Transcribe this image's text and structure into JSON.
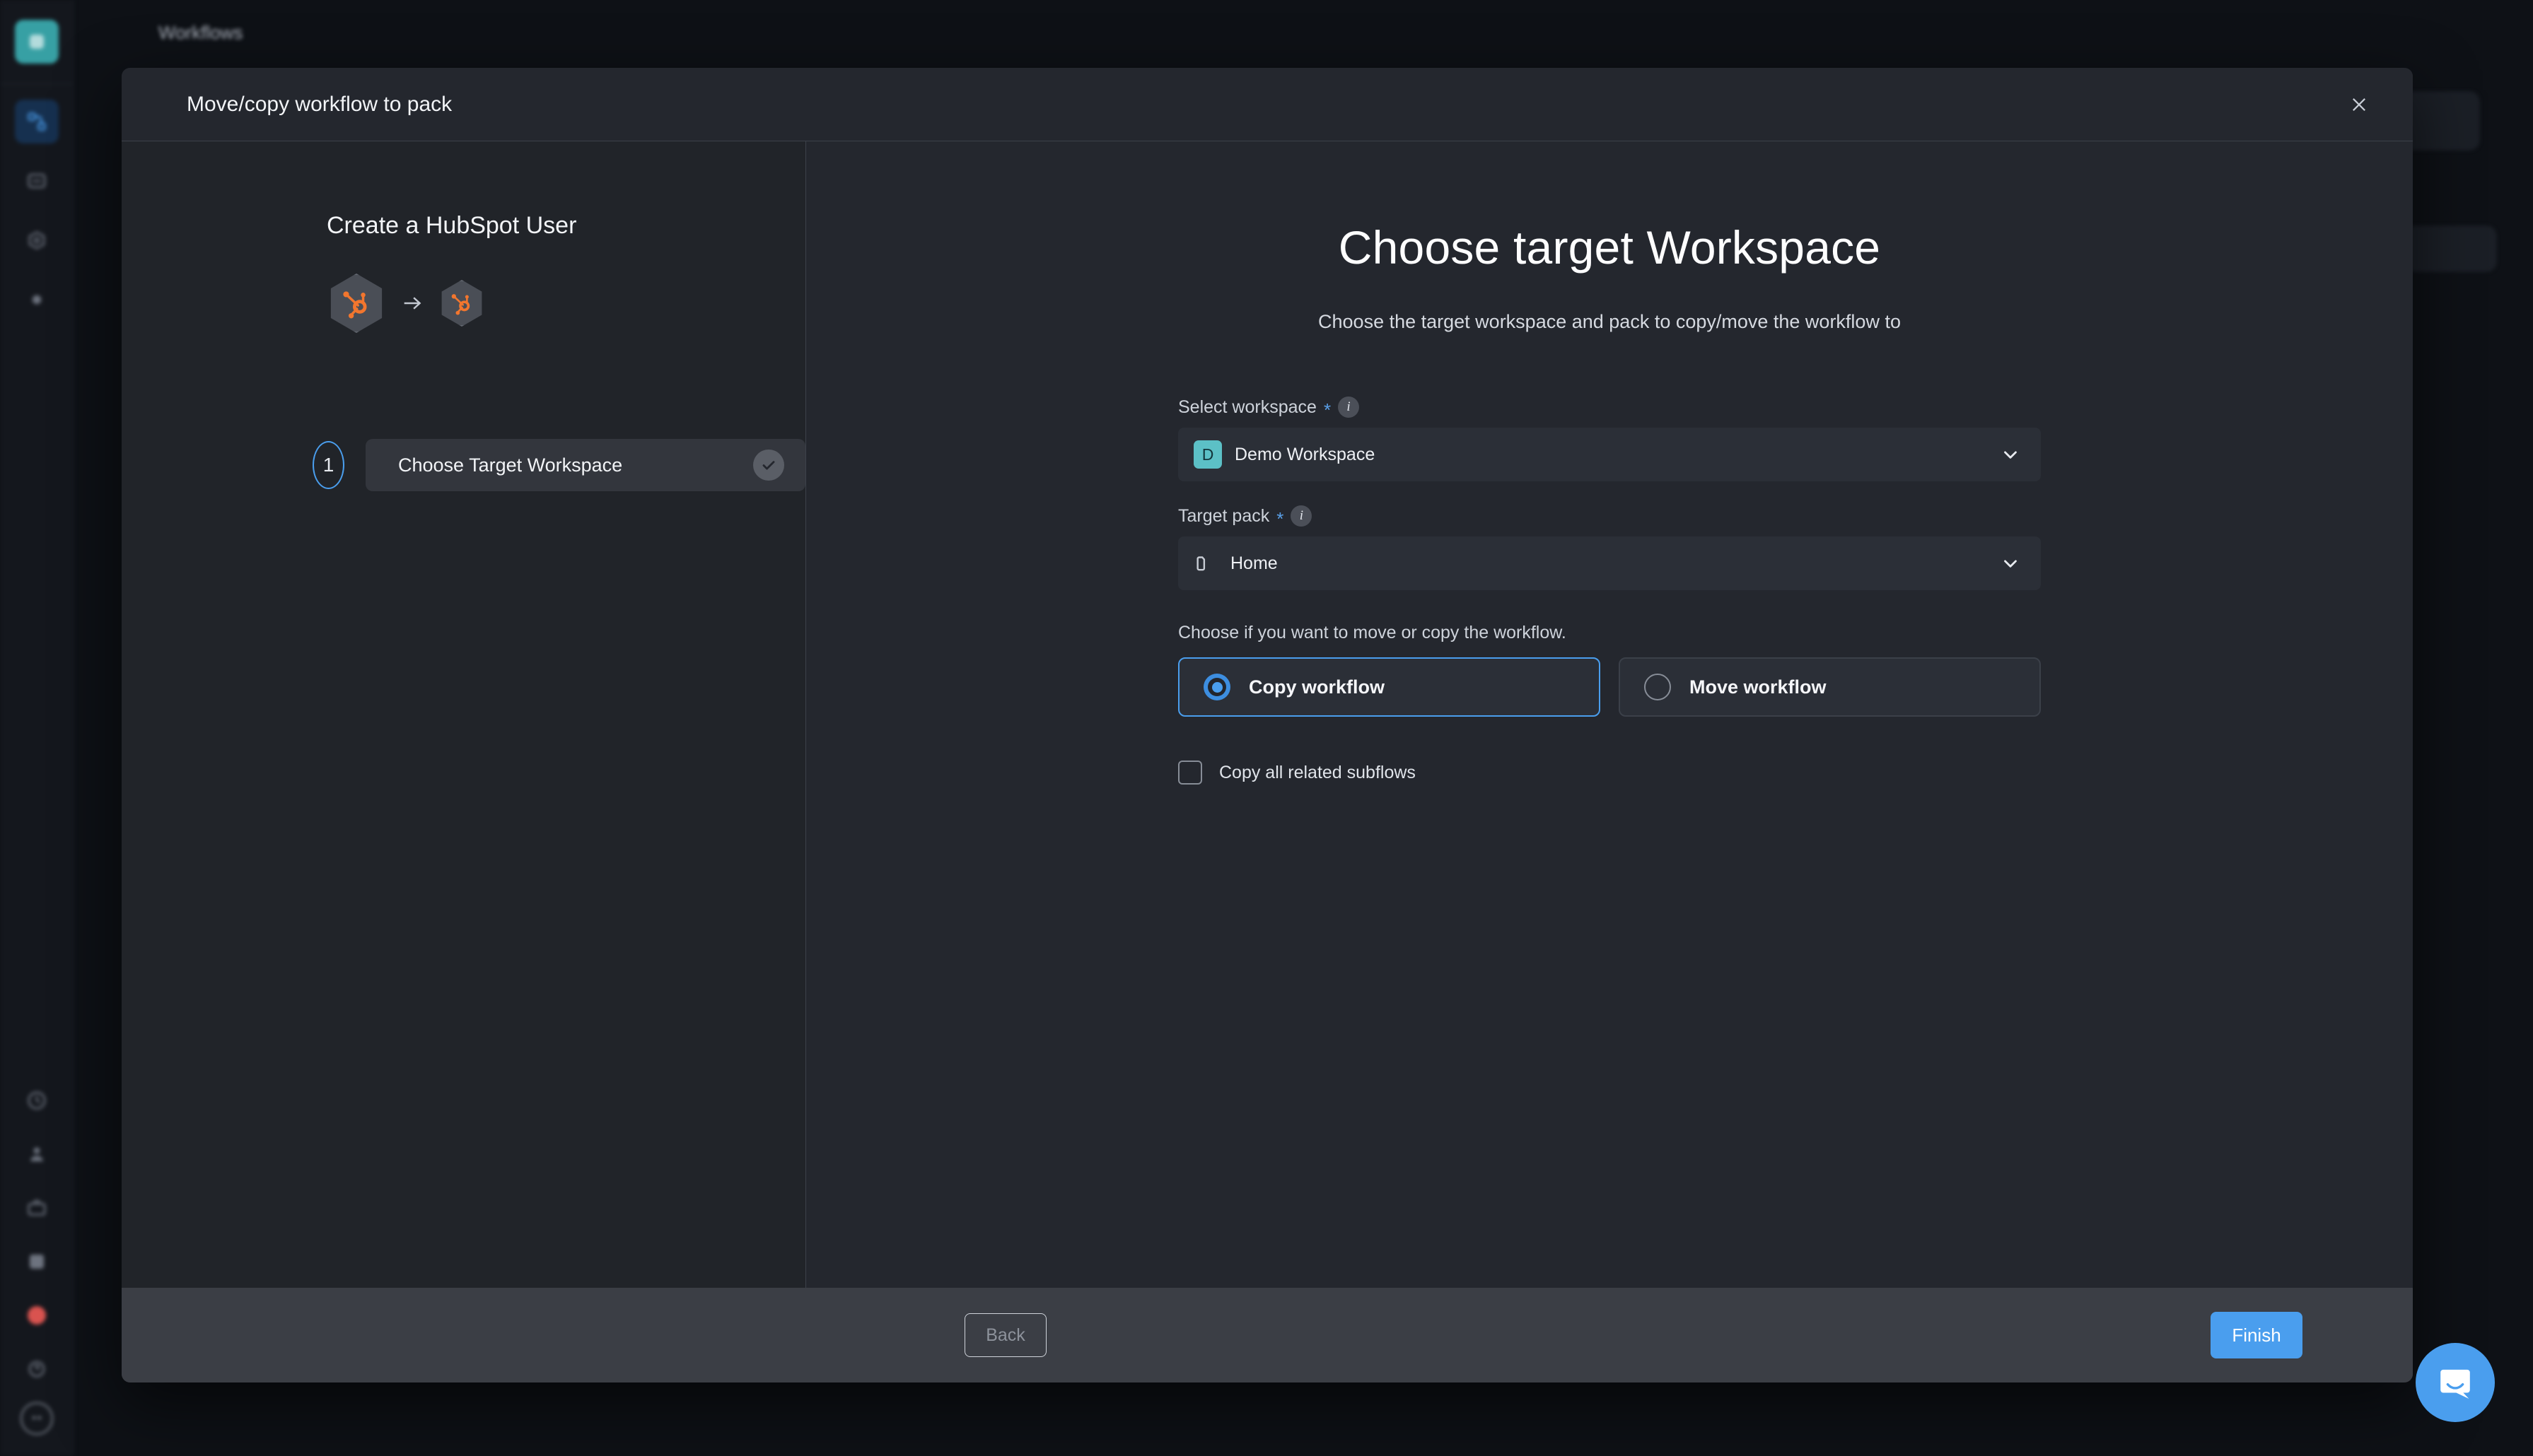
{
  "app": {
    "topbar": {
      "title": "Workflows"
    },
    "sidebar": {
      "brand_label": "workspace-logo",
      "items": [
        {
          "name": "sidebar-item-workflows",
          "icon": "workflow-icon",
          "active": true
        },
        {
          "name": "sidebar-item-inbox",
          "icon": "inbox-icon",
          "active": false
        },
        {
          "name": "sidebar-item-packs",
          "icon": "packs-icon",
          "active": false
        },
        {
          "name": "sidebar-item-settings",
          "icon": "gear-icon",
          "active": false
        }
      ],
      "bottom_items": [
        {
          "name": "sidebar-item-history",
          "icon": "clock-icon"
        },
        {
          "name": "sidebar-item-people",
          "icon": "person-icon"
        },
        {
          "name": "sidebar-item-jobs",
          "icon": "briefcase-icon"
        },
        {
          "name": "sidebar-item-apps",
          "icon": "grid-icon"
        },
        {
          "name": "sidebar-item-alerts",
          "icon": "notification-dot-icon"
        },
        {
          "name": "sidebar-item-help",
          "icon": "help-icon"
        }
      ]
    }
  },
  "modal": {
    "title": "Move/copy workflow to pack",
    "close_icon": "close-icon",
    "left": {
      "workflow_name": "Create a HubSpot User",
      "source_icon": "hubspot-icon",
      "arrow_icon": "arrow-right-icon",
      "target_icon": "hubspot-icon",
      "steps": [
        {
          "number": "1",
          "label": "Choose Target Workspace",
          "check_icon": "check-icon"
        }
      ]
    },
    "right": {
      "heading": "Choose target Workspace",
      "subtitle": "Choose the target workspace and pack to copy/move the workflow to",
      "fields": [
        {
          "label": "Select workspace",
          "required_marker": "*",
          "info_icon": "info-icon",
          "avatar_letter": "D",
          "value": "Demo Workspace",
          "chevron_icon": "chevron-down-icon"
        },
        {
          "label": "Target pack",
          "required_marker": "*",
          "info_icon": "info-icon",
          "folder_icon": "folder-icon",
          "value": "Home",
          "chevron_icon": "chevron-down-icon"
        }
      ],
      "choice_label": "Choose if you want to move or copy the workflow.",
      "choices": [
        {
          "label": "Copy workflow",
          "selected": true
        },
        {
          "label": "Move workflow",
          "selected": false
        }
      ],
      "checkbox": {
        "label": "Copy all related subflows",
        "checked": false
      }
    },
    "footer": {
      "back_label": "Back",
      "finish_label": "Finish"
    }
  },
  "chat": {
    "icon": "chat-bubble-icon"
  },
  "colors": {
    "accent_blue": "#4a9eee",
    "workspace_teal": "#5cc0c6",
    "hubspot_orange": "#f2762e",
    "modal_bg": "#24272e",
    "footer_bg": "#3b3e45",
    "alert_red": "#d9534f"
  }
}
